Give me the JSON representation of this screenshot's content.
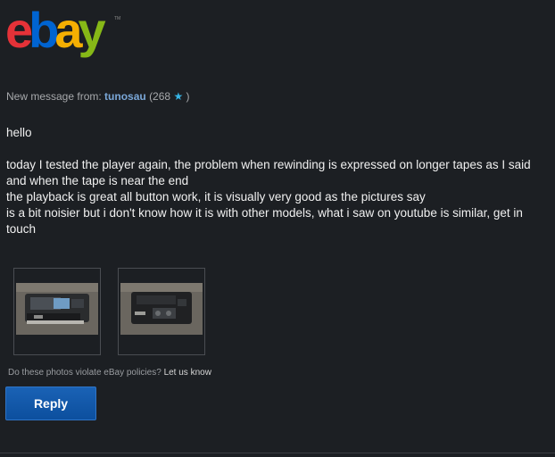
{
  "brand": {
    "logo_letters": [
      "e",
      "b",
      "a",
      "y"
    ],
    "tm": "TM",
    "colors": {
      "e": "#e53238",
      "b": "#0064d2",
      "a": "#f5af02",
      "y": "#86b817"
    }
  },
  "header": {
    "prefix": "New message from:",
    "username": "tunosau",
    "feedback_open": "(268",
    "feedback_close": ")",
    "star_icon": "star-icon"
  },
  "message": {
    "greeting": "hello",
    "lines": [
      "today I tested the player again, the problem when rewinding is expressed on longer tapes as I said and when the tape is near the end",
      "the playback is great all button work, it is visually very good as the pictures say",
      "is a bit noisier but i don't know how it is with other models, what i saw on youtube is similar, get in touch"
    ]
  },
  "attachments": {
    "photos": [
      "photo-1",
      "photo-2"
    ]
  },
  "policy": {
    "question": "Do these photos violate eBay policies?",
    "link": "Let us know"
  },
  "actions": {
    "reply_label": "Reply"
  },
  "colors": {
    "background": "#1c1f23",
    "reply_button": "#1a62b5",
    "username": "#7aa7d8"
  }
}
